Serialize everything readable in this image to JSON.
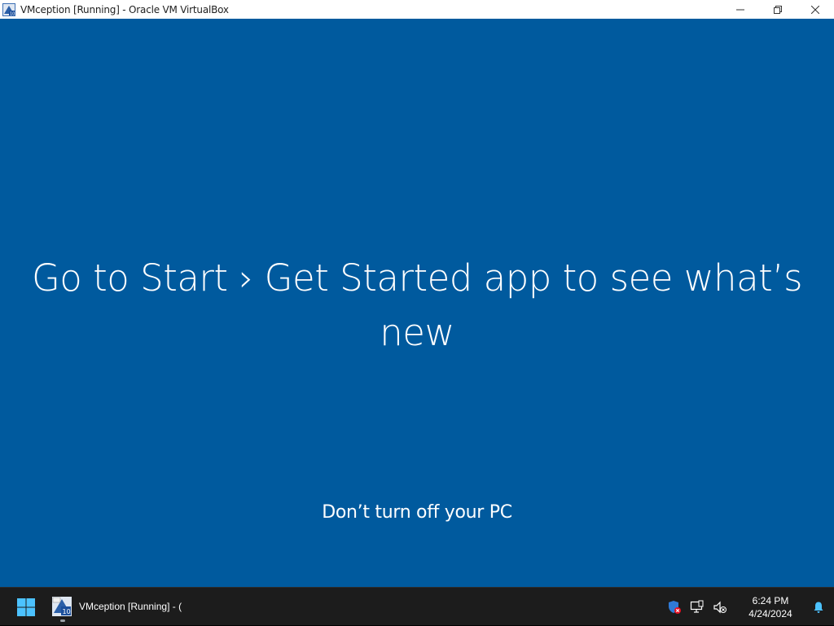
{
  "window": {
    "title": "VMception [Running] - Oracle VM VirtualBox",
    "controls": {
      "minimize": "minimize",
      "restore": "restore",
      "close": "close"
    }
  },
  "guest": {
    "main_message_line1": "Go to Start › Get Started app to see what’s",
    "main_message_line2": "new",
    "sub_message": "Don’t turn off your PC",
    "background_color": "#005A9E"
  },
  "taskbar": {
    "start_icon": "windows-start-icon",
    "task_item_label": "VMception [Running] - (",
    "tray": {
      "icons": [
        "security-warning-icon",
        "network-disconnected-icon",
        "volume-muted-icon"
      ],
      "time": "6:24 PM",
      "date": "4/24/2024",
      "notification_icon": "bell-icon"
    }
  }
}
